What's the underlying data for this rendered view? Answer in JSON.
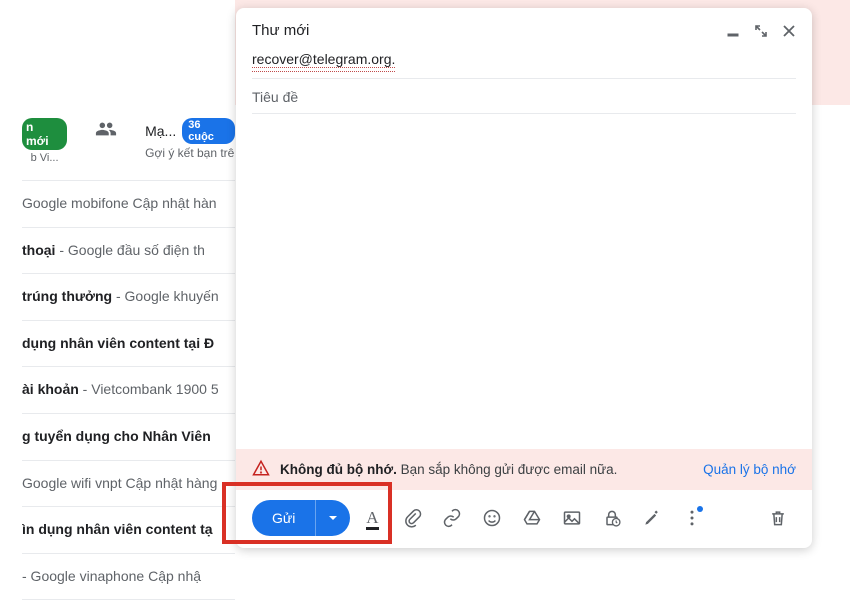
{
  "compose": {
    "title": "Thư mới",
    "to": "recover@telegram.org.",
    "subject_placeholder": "Tiêu đề",
    "warning": {
      "bold": "Không đủ bộ nhớ.",
      "rest": " Bạn sắp không gửi được email nữa.",
      "link": "Quản lý bộ nhớ"
    },
    "send_label": "Gửi"
  },
  "tabs": {
    "badge1": "n mới",
    "badge1_sub": "b Vi...",
    "tab3_name": "Mạ...",
    "tab3_count": "36 cuộc",
    "tab3_sub": "Gợi ý kết bạn trê"
  },
  "mails": [
    {
      "bold": "",
      "plain": "Google mobifone Cập nhật hàn"
    },
    {
      "bold": "thoại",
      "plain": " - Google đầu số điện th"
    },
    {
      "bold": "trúng thưởng",
      "plain": " - Google khuyến"
    },
    {
      "bold": "dụng nhân viên content tại Đ",
      "plain": ""
    },
    {
      "bold": "ài khoản",
      "plain": " - Vietcombank 1900 5"
    },
    {
      "bold": "g tuyển dụng cho Nhân Viên",
      "plain": ""
    },
    {
      "bold": "",
      "plain": "Google wifi vnpt Cập nhật hàng"
    },
    {
      "bold": "ìn dụng nhân viên content tạ",
      "plain": ""
    },
    {
      "bold": "",
      "plain": " - Google vinaphone Cập nhậ"
    }
  ]
}
